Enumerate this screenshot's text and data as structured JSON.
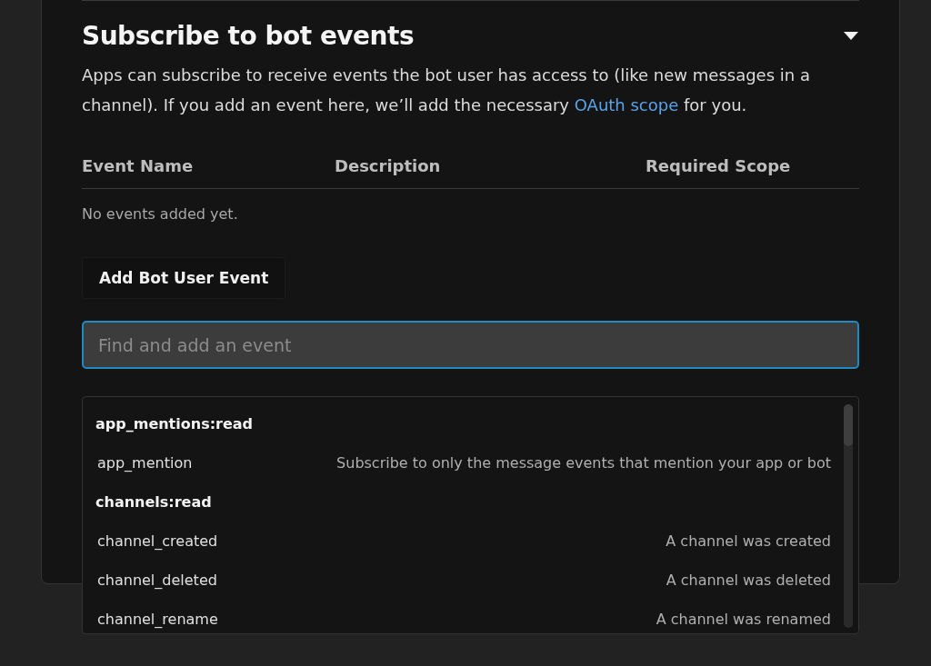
{
  "section": {
    "title": "Subscribe to bot events",
    "expanded": true,
    "description": {
      "before": "Apps can subscribe to receive events the bot user has access to (like new messages in a channel). If you add an event here, we’ll add the necessary ",
      "link": "OAuth scope",
      "after": " for you."
    }
  },
  "table": {
    "columns": [
      "Event Name",
      "Description",
      "Required Scope"
    ],
    "empty_text": "No events added yet."
  },
  "add_button": "Add Bot User Event",
  "search": {
    "placeholder": "Find and add an event"
  },
  "dropdown": [
    {
      "kind": "group",
      "name": "app_mentions:read"
    },
    {
      "kind": "event",
      "name": "app_mention",
      "description": "Subscribe to only the message events that mention your app or bot"
    },
    {
      "kind": "group",
      "name": "channels:read"
    },
    {
      "kind": "event",
      "name": "channel_created",
      "description": "A channel was created"
    },
    {
      "kind": "event",
      "name": "channel_deleted",
      "description": "A channel was deleted"
    },
    {
      "kind": "event",
      "name": "channel_rename",
      "description": "A channel was renamed"
    }
  ]
}
